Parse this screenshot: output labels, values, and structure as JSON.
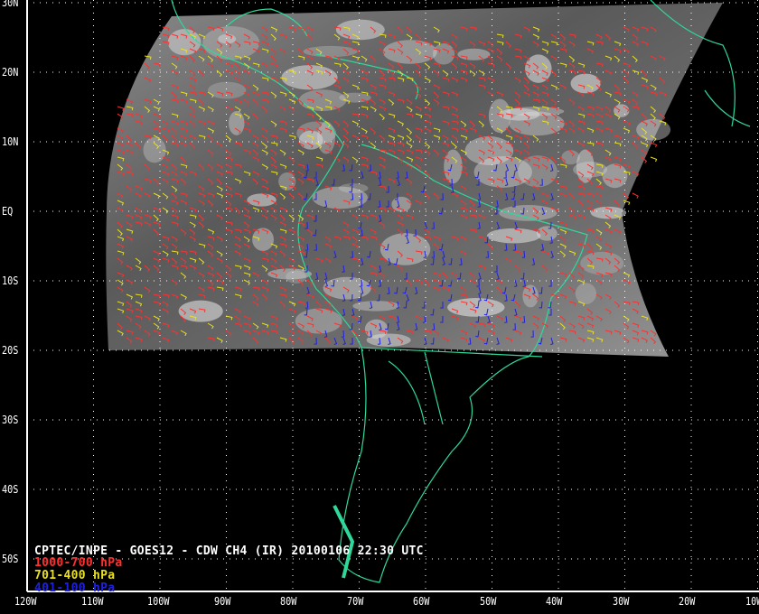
{
  "title": "CPTEC/INPE - GOES12 - CDW CH4 (IR) 20100106 22:30 UTC",
  "legend": [
    {
      "label": "1000-700 hPa",
      "color": "#ff3030"
    },
    {
      "label": "701-400 hPa",
      "color": "#e8e020"
    },
    {
      "label": "401-100 hPa",
      "color": "#2020e0"
    }
  ],
  "lat_labels": [
    "30N",
    "20N",
    "10N",
    "EQ",
    "10S",
    "20S",
    "30S",
    "40S",
    "50S"
  ],
  "lon_labels": [
    "120W",
    "110W",
    "100W",
    "90W",
    "80W",
    "70W",
    "60W",
    "50W",
    "40W",
    "30W",
    "20W",
    "10W"
  ],
  "colors": {
    "coast": "#2fd89a",
    "grid": "#ffffff",
    "background": "#000000"
  }
}
